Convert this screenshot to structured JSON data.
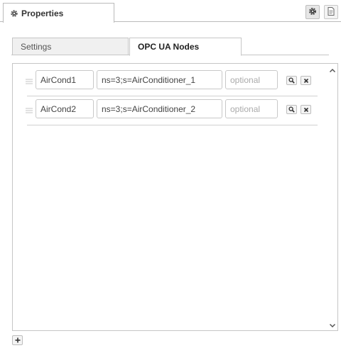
{
  "header": {
    "tab_label": "Properties",
    "tab_icon": "gear-icon",
    "settings_button_icon": "gear-icon",
    "info_button_icon": "document-icon"
  },
  "subtabs": [
    {
      "label": "Settings",
      "active": false
    },
    {
      "label": "OPC UA Nodes",
      "active": true
    }
  ],
  "nodes": [
    {
      "name": "AirCond1",
      "node_id": "ns=3;s=AirConditioner_1",
      "extra_value": "",
      "extra_placeholder": "optional"
    },
    {
      "name": "AirCond2",
      "node_id": "ns=3;s=AirConditioner_2",
      "extra_value": "",
      "extra_placeholder": "optional"
    }
  ],
  "row_buttons": {
    "browse_icon": "search-icon",
    "remove_icon": "close-icon"
  },
  "list_footer": {
    "add_icon": "plus-icon"
  },
  "colors": {
    "border": "#c6c6c6",
    "tab_inactive_bg": "#f0f0f0",
    "text": "#333333",
    "placeholder": "#aaaaaa"
  }
}
